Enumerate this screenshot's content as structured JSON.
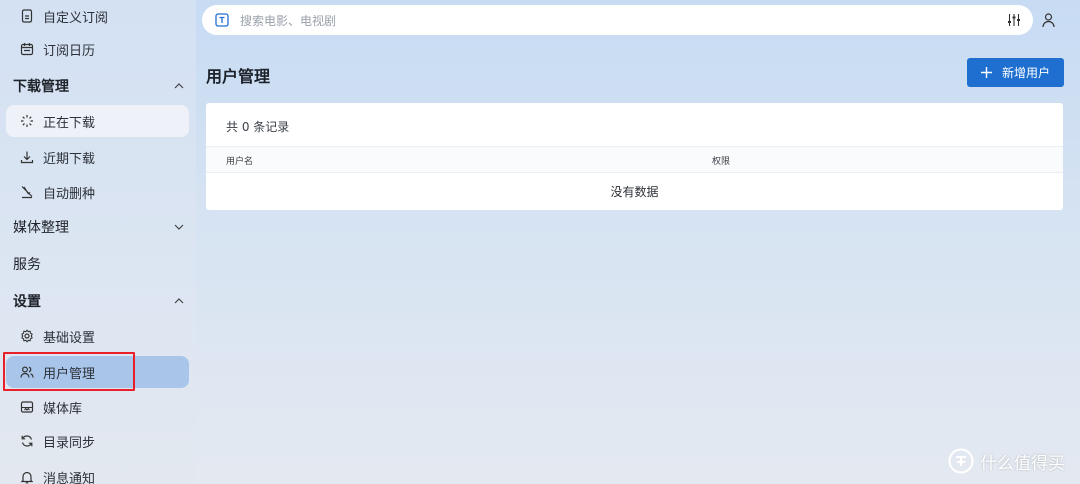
{
  "sidebar": {
    "items": [
      {
        "label": "自定义订阅",
        "icon": "document-icon"
      },
      {
        "label": "订阅日历",
        "icon": "calendar-icon"
      }
    ],
    "groups": {
      "download": {
        "label": "下载管理",
        "expanded": true,
        "items": [
          {
            "label": "正在下载",
            "icon": "loading-icon"
          },
          {
            "label": "近期下载",
            "icon": "download-icon"
          },
          {
            "label": "自动删种",
            "icon": "auto-delete-icon"
          }
        ]
      },
      "media": {
        "label": "媒体整理",
        "expanded": false
      },
      "service": {
        "label": "服务"
      },
      "settings": {
        "label": "设置",
        "expanded": true,
        "items": [
          {
            "label": "基础设置",
            "icon": "gear-icon"
          },
          {
            "label": "用户管理",
            "icon": "users-icon",
            "active": true
          },
          {
            "label": "媒体库",
            "icon": "media-library-icon"
          },
          {
            "label": "目录同步",
            "icon": "sync-icon"
          },
          {
            "label": "消息通知",
            "icon": "bell-icon"
          }
        ]
      }
    }
  },
  "search": {
    "placeholder": "搜索电影、电视剧"
  },
  "page": {
    "title": "用户管理",
    "add_button_label": "新增用户"
  },
  "table": {
    "record_count": "共 0 条记录",
    "columns": [
      "用户名",
      "权限"
    ],
    "rows": [],
    "empty_text": "没有数据"
  },
  "watermark": {
    "text": "什么值得买"
  },
  "colors": {
    "accent": "#1f6fd1",
    "active_nav": "#a9c6ea",
    "highlight_box": "#e8202a"
  }
}
